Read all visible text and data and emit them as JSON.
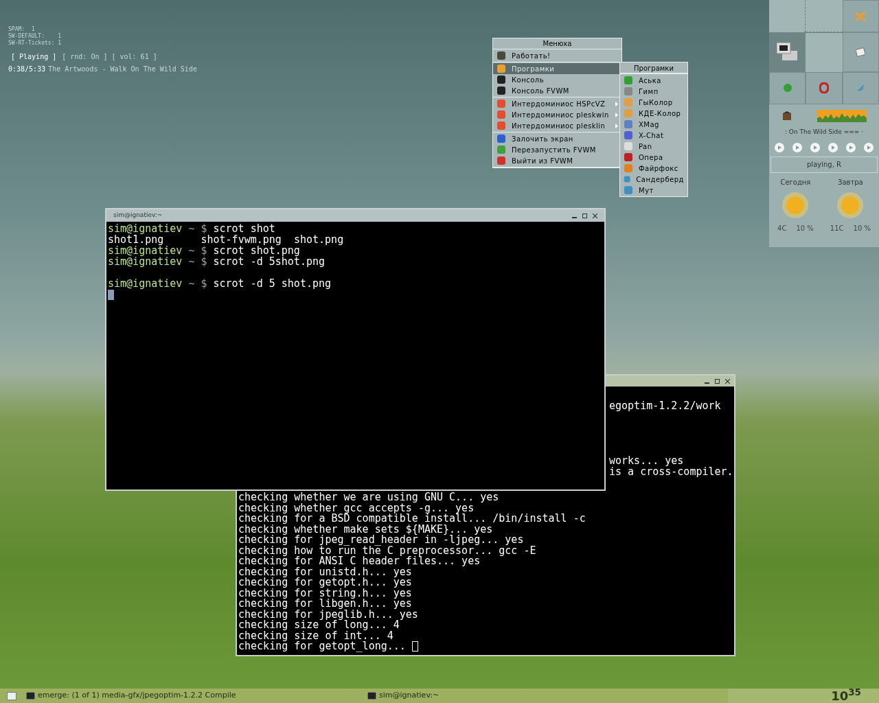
{
  "conky": {
    "lines": [
      "SPAM:  1",
      "SW-DEFAULT:    1",
      "SW-RT-Tickets: 1"
    ],
    "status": [
      "[ Playing ]",
      "[ rnd: On ] [ vol: 61 ]"
    ],
    "time": "0:38/5:33",
    "track": "The Artwoods - Walk On The Wild Side"
  },
  "menu": {
    "title": "Менюха",
    "groups": [
      [
        {
          "label": "Работать!",
          "selected": false,
          "submenu": false
        }
      ],
      [
        {
          "label": "Програмки",
          "selected": true,
          "submenu": false
        },
        {
          "label": "Консоль",
          "selected": false,
          "submenu": false
        },
        {
          "label": "Консоль FVWM",
          "selected": false,
          "submenu": false
        }
      ],
      [
        {
          "label": "Интердоминиос HSPcVZ",
          "selected": false,
          "submenu": true
        },
        {
          "label": "Интердоминиос pleskwin",
          "selected": false,
          "submenu": true
        },
        {
          "label": "Интердоминиос plesklin",
          "selected": false,
          "submenu": true
        }
      ],
      [
        {
          "label": "Залочить экран",
          "selected": false,
          "submenu": false
        },
        {
          "label": "Перезапустить FVWM",
          "selected": false,
          "submenu": false
        },
        {
          "label": "Выйти из FVWM",
          "selected": false,
          "submenu": false
        }
      ]
    ]
  },
  "submenu": {
    "title": "Програмки",
    "items": [
      "Аська",
      "Гимп",
      "ГыКолор",
      "КДЕ-Колор",
      "XMag",
      "X-Chat",
      "Pan",
      "Опера",
      "Файрфокс",
      "Сандерберд",
      "Мут"
    ]
  },
  "front_terminal": {
    "title": "sim@ignatiev:~",
    "lines": [
      {
        "kind": "prompt",
        "user": "sim@ignatiev",
        "path": "~ $",
        "command": "scrot shot"
      },
      {
        "kind": "output",
        "text": "shot1.png      shot-fvwm.png  shot.png"
      },
      {
        "kind": "prompt",
        "user": "sim@ignatiev",
        "path": "~ $",
        "command": "scrot shot.png"
      },
      {
        "kind": "prompt",
        "user": "sim@ignatiev",
        "path": "~ $",
        "command": "scrot -d 5shot.png"
      },
      {
        "kind": "blank"
      },
      {
        "kind": "prompt",
        "user": "sim@ignatiev",
        "path": "~ $",
        "command": "scrot -d 5 shot.png"
      },
      {
        "kind": "cursor"
      }
    ]
  },
  "back_terminal": {
    "fragment_groups": [
      [
        "egoptim-1.2.2/work"
      ],
      [
        "works... yes",
        "is a cross-compiler."
      ]
    ],
    "lines": [
      "checking whether we are using GNU C... yes",
      "checking whether gcc accepts -g... yes",
      "checking for a BSD compatible install... /bin/install -c",
      "checking whether make sets ${MAKE}... yes",
      "checking for jpeg_read_header in -ljpeg... yes",
      "checking how to run the C preprocessor... gcc -E",
      "checking for ANSI C header files... yes",
      "checking for unistd.h... yes",
      "checking for getopt.h... yes",
      "checking for string.h... yes",
      "checking for libgen.h... yes",
      "checking for jpeglib.h... yes",
      "checking size of long... 4",
      "checking size of int... 4",
      "checking for getopt_long... "
    ]
  },
  "panel": {
    "player_title": ": On The Wild Side ≈≈≈ ·",
    "player_status": "playing, R",
    "weather": [
      {
        "day": "Сегодня",
        "temp": "4C",
        "humidity": "10 %"
      },
      {
        "day": "Завтра",
        "temp": "11C",
        "humidity": "10 %"
      }
    ]
  },
  "taskbar": {
    "tasks": [
      "emerge: (1 of 1) media-gfx/jpegoptim-1.2.2 Compile",
      "sim@ignatiev:~"
    ],
    "clock": "10$^{35}$"
  }
}
